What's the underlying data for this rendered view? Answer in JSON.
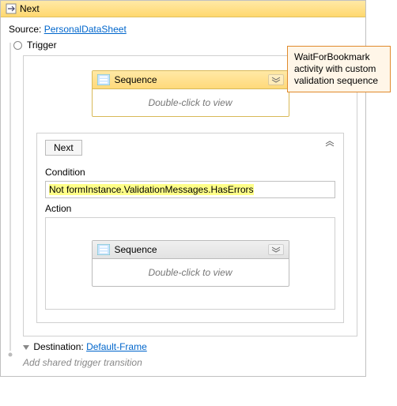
{
  "title": "Next",
  "source": {
    "label": "Source:",
    "link": "PersonalDataSheet"
  },
  "trigger": {
    "label": "Trigger"
  },
  "sequence1": {
    "title": "Sequence",
    "hint": "Double-click to view"
  },
  "nextBox": {
    "button": "Next",
    "conditionLabel": "Condition",
    "conditionValue": "Not formInstance.ValidationMessages.HasErrors",
    "actionLabel": "Action"
  },
  "sequence2": {
    "title": "Sequence",
    "hint": "Double-click to view"
  },
  "destination": {
    "label": "Destination:",
    "link": "Default-Frame"
  },
  "addTrigger": "Add shared trigger transition",
  "callout": "WaitForBookmark activity with custom validation sequence"
}
